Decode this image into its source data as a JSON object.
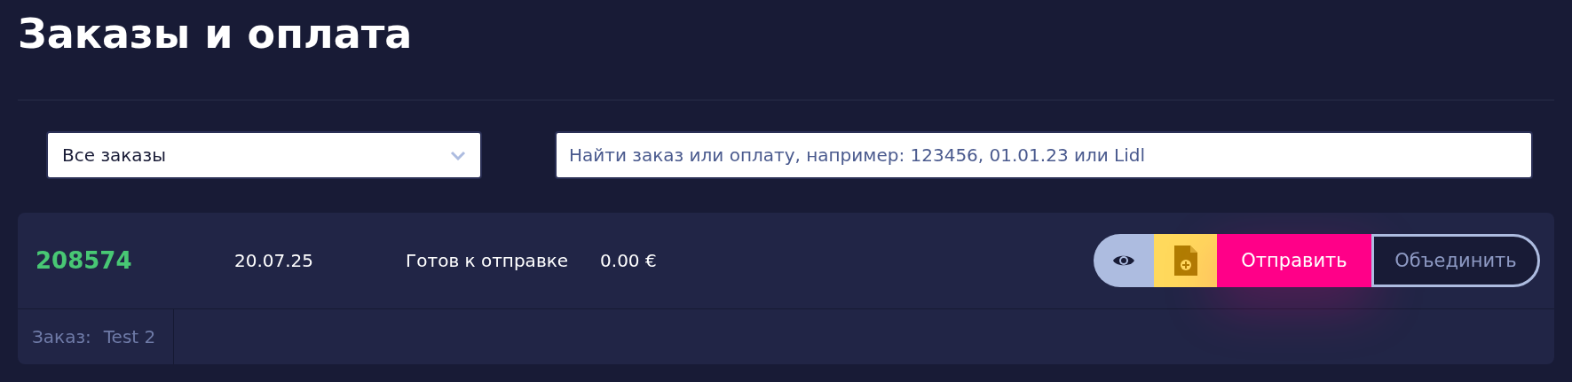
{
  "title": "Заказы и оплата",
  "filter": {
    "value": "Все заказы"
  },
  "search": {
    "placeholder": "Найти заказ или оплату, например: 123456, 01.01.23 или Lidl"
  },
  "orders": [
    {
      "number": "208574",
      "date": "20.07.25",
      "status": "Готов к отправке",
      "amount": "0.00 €",
      "actions": [
        {
          "kind": "view"
        },
        {
          "kind": "invoice"
        },
        {
          "kind": "send",
          "label": "Отправить"
        },
        {
          "kind": "merge",
          "label": "Объединить"
        }
      ],
      "details": [
        {
          "label": "Заказ:",
          "value": "Test 2"
        }
      ]
    }
  ]
}
